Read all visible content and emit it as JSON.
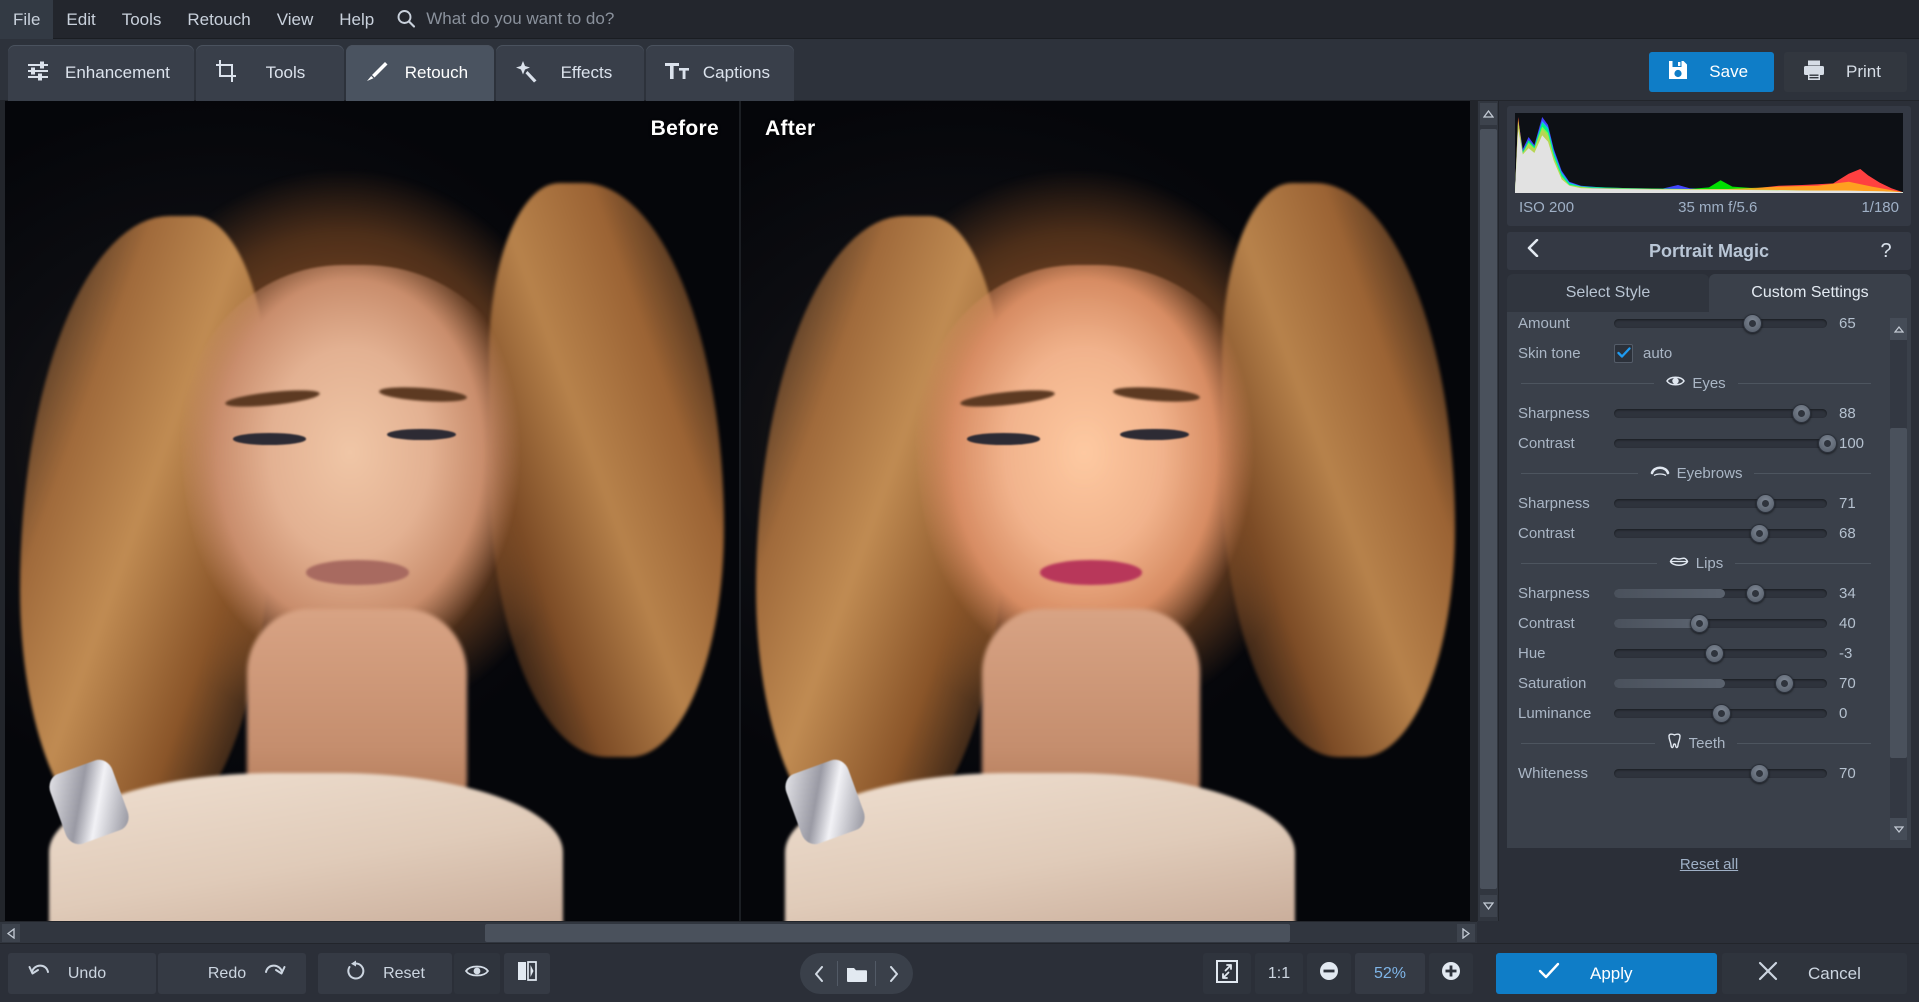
{
  "menubar": {
    "items": [
      "File",
      "Edit",
      "Tools",
      "Retouch",
      "View",
      "Help"
    ],
    "search_placeholder": "What do you want to do?",
    "search_icon": "search-icon"
  },
  "tabbar": {
    "tabs": [
      {
        "label": "Enhancement",
        "icon": "sliders-icon",
        "active": false
      },
      {
        "label": "Tools",
        "icon": "crop-icon",
        "active": false
      },
      {
        "label": "Retouch",
        "icon": "brush-icon",
        "active": true
      },
      {
        "label": "Effects",
        "icon": "magic-wand-icon",
        "active": false
      },
      {
        "label": "Captions",
        "icon": "text-icon",
        "active": false
      }
    ],
    "save_label": "Save",
    "save_icon": "floppy-disk-icon",
    "print_label": "Print",
    "print_icon": "printer-icon",
    "accent_color": "#0f7dc7"
  },
  "canvas": {
    "before_label": "Before",
    "after_label": "After"
  },
  "right_panel": {
    "histogram": {
      "iso": "ISO 200",
      "lens": "35 mm f/5.6",
      "shutter": "1/180"
    },
    "module_title": "Portrait Magic",
    "back_icon": "chevron-left-icon",
    "help_icon": "question-mark-icon",
    "tabs": [
      {
        "label": "Select Style",
        "active": false
      },
      {
        "label": "Custom Settings",
        "active": true
      }
    ],
    "reset_all_label": "Reset all",
    "settings": [
      {
        "kind": "slider",
        "label": "Amount",
        "value": "65",
        "pos": 65,
        "fill": 0,
        "min": 0,
        "max": 100
      },
      {
        "kind": "check",
        "label": "Skin tone",
        "checked": true,
        "check_label": "auto"
      },
      {
        "kind": "section",
        "label": "Eyes",
        "icon": "eye-icon"
      },
      {
        "kind": "slider",
        "label": "Sharpness",
        "value": "88",
        "pos": 88,
        "fill": 0,
        "min": 0,
        "max": 100
      },
      {
        "kind": "slider",
        "label": "Contrast",
        "value": "100",
        "pos": 100,
        "fill": 0,
        "min": 0,
        "max": 100
      },
      {
        "kind": "section",
        "label": "Eyebrows",
        "icon": "eyebrow-icon"
      },
      {
        "kind": "slider",
        "label": "Sharpness",
        "value": "71",
        "pos": 71,
        "fill": 0,
        "min": 0,
        "max": 100
      },
      {
        "kind": "slider",
        "label": "Contrast",
        "value": "68",
        "pos": 68,
        "fill": 0,
        "min": 0,
        "max": 100
      },
      {
        "kind": "section",
        "label": "Lips",
        "icon": "lips-icon"
      },
      {
        "kind": "slider",
        "label": "Sharpness",
        "value": "34",
        "pos": 66,
        "fill": 52,
        "min": 0,
        "max": 100
      },
      {
        "kind": "slider",
        "label": "Contrast",
        "value": "40",
        "pos": 40,
        "fill": 40,
        "min": 0,
        "max": 100
      },
      {
        "kind": "slider",
        "label": "Hue",
        "value": "-3",
        "pos": 47,
        "fill": 0,
        "min": -100,
        "max": 100
      },
      {
        "kind": "slider",
        "label": "Saturation",
        "value": "70",
        "pos": 80,
        "fill": 52,
        "min": 0,
        "max": 100
      },
      {
        "kind": "slider",
        "label": "Luminance",
        "value": "0",
        "pos": 50,
        "fill": 0,
        "min": -100,
        "max": 100
      },
      {
        "kind": "section",
        "label": "Teeth",
        "icon": "tooth-icon"
      },
      {
        "kind": "slider",
        "label": "Whiteness",
        "value": "70",
        "pos": 68,
        "fill": 0,
        "min": 0,
        "max": 100
      }
    ]
  },
  "bottombar": {
    "undo_label": "Undo",
    "undo_icon": "undo-arrow-icon",
    "redo_label": "Redo",
    "redo_icon": "redo-arrow-icon",
    "reset_label": "Reset",
    "reset_icon": "reset-circle-icon",
    "preview_icon": "eye-icon",
    "compare_icon": "split-view-icon",
    "prev_icon": "chevron-left-icon",
    "folder_icon": "folder-icon",
    "next_icon": "chevron-right-icon",
    "fit_icon": "fit-to-screen-icon",
    "actual_size_label": "1:1",
    "zoom_out_icon": "minus-circle-icon",
    "zoom_level": "52%",
    "zoom_in_icon": "plus-circle-icon",
    "apply_label": "Apply",
    "apply_icon": "checkmark-icon",
    "cancel_label": "Cancel",
    "cancel_icon": "cross-icon"
  }
}
